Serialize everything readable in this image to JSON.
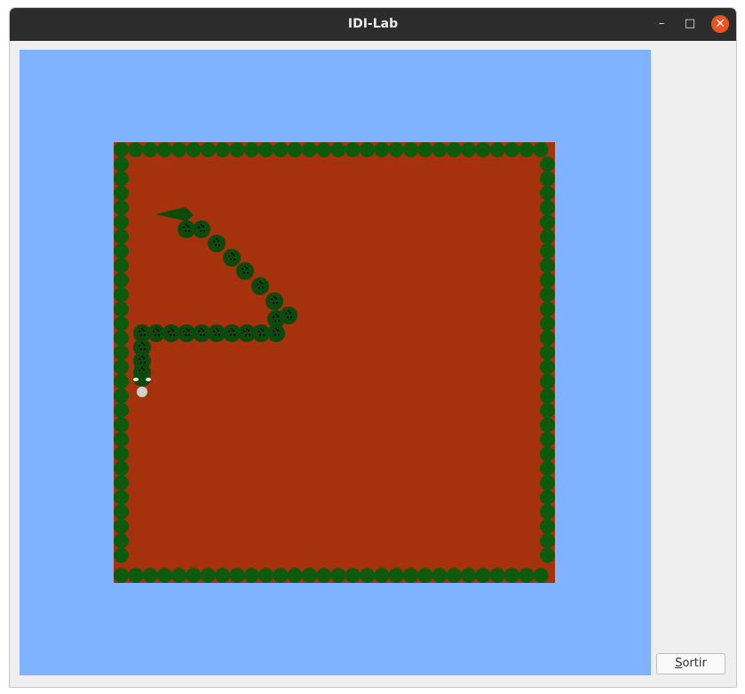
{
  "window": {
    "title": "IDI-Lab",
    "minimize_glyph": "–",
    "maximize_glyph": "□",
    "close_glyph": "✕",
    "close_color": "#e95420"
  },
  "colors": {
    "sky": "#80b3ff",
    "ground": "#a5320c",
    "wall": "#0c5a0c",
    "snake": "#0c4a0c",
    "spots": "#000000",
    "marble": "#d0d0d0"
  },
  "buttons": {
    "exit_mnemonic": "S",
    "exit_rest": "ortir"
  },
  "icons": {
    "minimize": "minimize-icon",
    "maximize": "maximize-icon",
    "close": "close-icon"
  }
}
